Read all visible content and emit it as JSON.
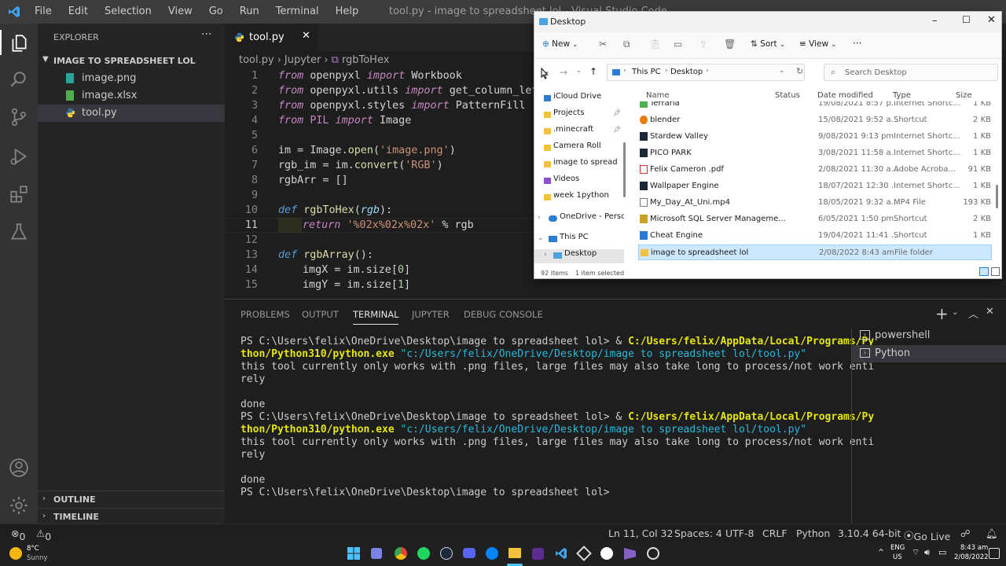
{
  "titlebar": {
    "menu": [
      "File",
      "Edit",
      "Selection",
      "View",
      "Go",
      "Run",
      "Terminal",
      "Help"
    ],
    "title": "tool.py - image to spreadsheet lol - Visual Studio Code"
  },
  "explorer": {
    "header": "EXPLORER",
    "folder": "IMAGE TO SPREADSHEET LOL",
    "files": [
      "image.png",
      "image.xlsx",
      "tool.py"
    ],
    "outline": "OUTLINE",
    "timeline": "TIMELINE"
  },
  "editor": {
    "tab": "tool.py",
    "breadcrumb": [
      "tool.py",
      "Jupyter",
      "rgbToHex"
    ],
    "line_numbers": [
      "1",
      "2",
      "3",
      "4",
      "5",
      "6",
      "7",
      "8",
      "9",
      "10",
      "11",
      "12",
      "13",
      "14",
      "15"
    ],
    "code": {
      "l1a": "from",
      "l1b": "openpyxl",
      "l1c": "import",
      "l1d": "Workbook",
      "l2a": "from",
      "l2b": "openpyxl.utils",
      "l2c": "import",
      "l2d": "get_column_letter",
      "l3a": "from",
      "l3b": "openpyxl.styles",
      "l3c": "import",
      "l3d": "PatternFill",
      "l4a": "from",
      "l4b": "PIL",
      "l4c": "import",
      "l4d": "Image",
      "l6a": "im = ",
      "l6b": "Image",
      "l6c": ".",
      "l6d": "open",
      "l6e": "(",
      "l6f": "'image.png'",
      "l6g": ")",
      "l7a": "rgb_im = im.",
      "l7b": "convert",
      "l7c": "(",
      "l7d": "'RGB'",
      "l7e": ")",
      "l8a": "rgbArr = []",
      "l10a": "def",
      "l10b": "rgbToHex",
      "l10c": "(",
      "l10d": "rgb",
      "l10e": "):",
      "l11a": "return",
      "l11b": "'%02x%02x%02x'",
      "l11c": " % rgb",
      "l13a": "def",
      "l13b": "rgbArray",
      "l13c": "():",
      "l14a": "imgX = im.size[",
      "l14b": "0",
      "l14c": "]",
      "l15a": "imgY = im.size[",
      "l15b": "1",
      "l15c": "]"
    }
  },
  "panel": {
    "tabs": [
      "PROBLEMS",
      "OUTPUT",
      "TERMINAL",
      "JUPYTER",
      "DEBUG CONSOLE"
    ],
    "terminals": [
      "powershell",
      "Python"
    ],
    "lines": {
      "t1a": "PS C:\\Users\\felix\\OneDrive\\Desktop\\image to spreadsheet lol> & ",
      "t1b": "C:/Users/felix/AppData/Local/Programs/Py",
      "t2a": "thon/Python310/python.exe",
      "t2b": " \"c:/Users/felix/OneDrive/Desktop/image to spreadsheet lol/tool.py\"",
      "t3": "this tool currently only works with .png files, large files may also take long to process/not work enti",
      "t4": "rely",
      "t6": "done",
      "t7a": "PS C:\\Users\\felix\\OneDrive\\Desktop\\image to spreadsheet lol> & ",
      "t7b": "C:/Users/felix/AppData/Local/Programs/Py",
      "t8a": "thon/Python310/python.exe",
      "t8b": " \"c:/Users/felix/OneDrive/Desktop/image to spreadsheet lol/tool.py\"",
      "t9": "this tool currently only works with .png files, large files may also take long to process/not work enti",
      "t10": "rely",
      "t12": "done",
      "t13": "PS C:\\Users\\felix\\OneDrive\\Desktop\\image to spreadsheet lol>"
    }
  },
  "statusbar": {
    "errors": "0",
    "warnings": "0",
    "position": "Ln 11, Col 32",
    "spaces": "Spaces: 4",
    "encoding": "UTF-8",
    "eol": "CRLF",
    "language": "Python",
    "interpreter": "3.10.4 64-bit",
    "golive": "Go Live"
  },
  "taskbar": {
    "temp": "8°C",
    "weather": "Sunny",
    "lang1": "ENG",
    "lang2": "US",
    "time": "8:43 am",
    "date": "2/08/2022"
  },
  "file_explorer": {
    "title": "Desktop",
    "new_label": "New",
    "sort_label": "Sort",
    "view_label": "View",
    "more_label": "···",
    "path": [
      "This PC",
      "Desktop"
    ],
    "search_placeholder": "Search Desktop",
    "columns": [
      "Name",
      "Status",
      "Date modified",
      "Type",
      "Size"
    ],
    "nav": [
      "iCloud Drive",
      "Projects",
      ".minecraft",
      "Camera Roll",
      "image to spread",
      "Videos",
      "week 1python",
      "OneDrive - Perso",
      "This PC",
      "Desktop"
    ],
    "files": [
      {
        "name": "Terraria",
        "date": "19/08/2021 8:57 p...",
        "type": "Internet Shortc...",
        "size": "1 KB"
      },
      {
        "name": "blender",
        "date": "15/08/2021 9:52 a...",
        "type": "Shortcut",
        "size": "2 KB"
      },
      {
        "name": "Stardew Valley",
        "date": "9/08/2021 9:13 pm",
        "type": "Internet Shortc...",
        "size": "1 KB"
      },
      {
        "name": "PICO PARK",
        "date": "3/08/2021 11:58 a...",
        "type": "Internet Shortc...",
        "size": "1 KB"
      },
      {
        "name": "Felix Cameron .pdf",
        "date": "2/08/2021 11:30 a...",
        "type": "Adobe Acroba...",
        "size": "91 KB"
      },
      {
        "name": "Wallpaper Engine",
        "date": "18/07/2021 12:30 ...",
        "type": "Internet Shortc...",
        "size": "1 KB"
      },
      {
        "name": "My_Day_At_Uni.mp4",
        "date": "18/05/2021 9:32 a...",
        "type": "MP4 File",
        "size": "193 KB"
      },
      {
        "name": "Microsoft SQL Server Manageme...",
        "date": "6/05/2021 1:50 pm",
        "type": "Shortcut",
        "size": "2 KB"
      },
      {
        "name": "Cheat Engine",
        "date": "19/04/2021 11:41 ...",
        "type": "Shortcut",
        "size": "1 KB"
      },
      {
        "name": "image to spreadsheet lol",
        "date": "2/08/2022 8:43 am",
        "type": "File folder",
        "size": ""
      }
    ],
    "item_count": "92 items",
    "selected": "1 item selected"
  }
}
